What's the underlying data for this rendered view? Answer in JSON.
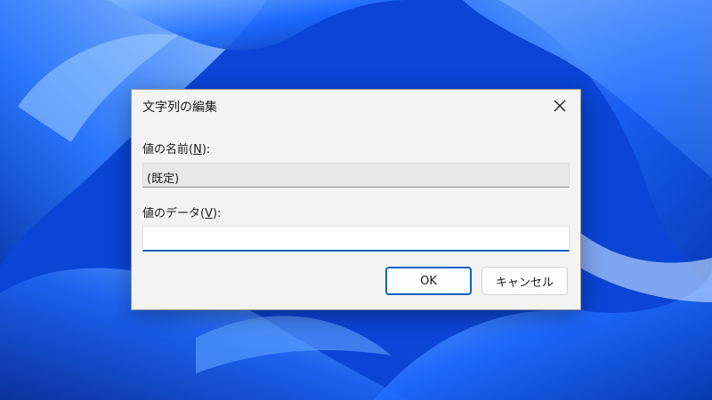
{
  "dialog": {
    "title": "文字列の編集",
    "value_name_label_prefix": "値の名前(",
    "value_name_label_key": "N",
    "value_name_label_suffix": "):",
    "value_name": "(既定)",
    "value_data_label_prefix": "値のデータ(",
    "value_data_label_key": "V",
    "value_data_label_suffix": "):",
    "value_data": "",
    "ok_label": "OK",
    "cancel_label": "キャンセル"
  },
  "icons": {
    "close": "close-icon"
  },
  "colors": {
    "accent": "#0a62c2",
    "dialog_bg": "#f3f3f3",
    "wallpaper": "#0b4fe0"
  }
}
